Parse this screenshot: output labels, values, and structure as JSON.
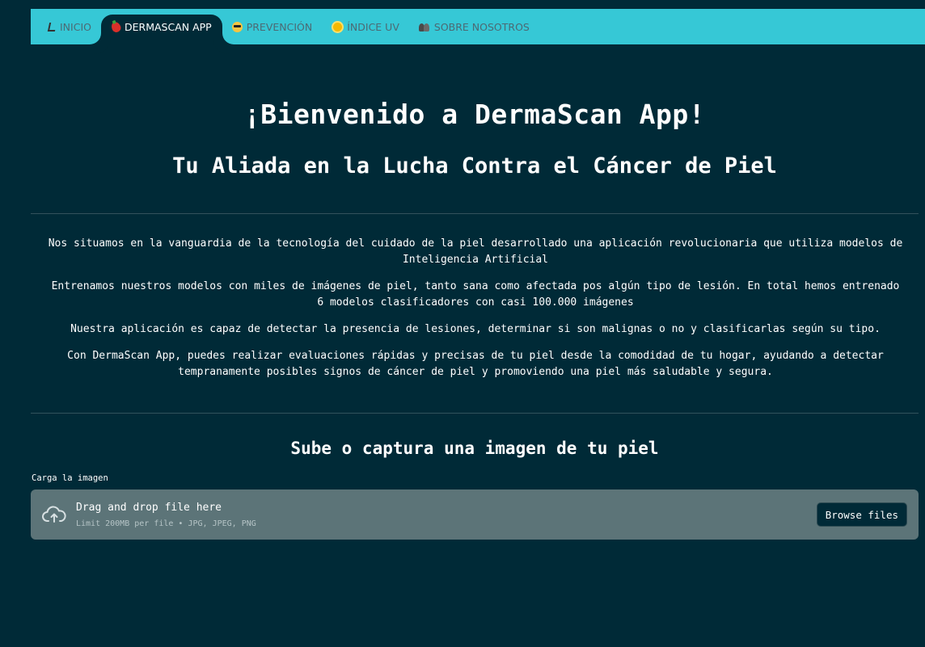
{
  "nav": {
    "items": [
      {
        "label": "INICIO",
        "icon": "home-icon",
        "active": false
      },
      {
        "label": "DERMASCAN APP",
        "icon": "pepper-icon",
        "active": true
      },
      {
        "label": "PREVENCIÓN",
        "icon": "cool-face-icon",
        "active": false
      },
      {
        "label": "ÍNDICE UV",
        "icon": "sun-icon",
        "active": false
      },
      {
        "label": "SOBRE NOSOTROS",
        "icon": "people-icon",
        "active": false
      }
    ],
    "bar_color": "#36c8d6"
  },
  "main": {
    "title": "¡Bienvenido a DermaScan App!",
    "subtitle": "Tu Aliada en la Lucha Contra el Cáncer de Piel",
    "paragraphs": [
      "Nos situamos en la vanguardia de la tecnología del cuidado de la piel desarrollado una aplicación revolucionaria que utiliza modelos de Inteligencia Artificial",
      "Entrenamos nuestros modelos con miles de imágenes de piel, tanto sana como afectada pos algún tipo de lesión. En total hemos entrenado 6 modelos clasificadores con casi 100.000 imágenes",
      "Nuestra aplicación es capaz de detectar la presencia de lesiones, determinar si son malignas o no y clasificarlas según su tipo.",
      "Con DermaScan App, puedes realizar evaluaciones rápidas y precisas de tu piel desde la comodidad de tu hogar, ayudando a detectar tempranamente posibles signos de cáncer de piel y promoviendo una piel más saludable y segura."
    ]
  },
  "upload": {
    "heading": "Sube o captura una imagen de tu piel",
    "label": "Carga la imagen",
    "drop_text": "Drag and drop file here",
    "limit_text": "Limit 200MB per file • JPG, JPEG, PNG",
    "browse_label": "Browse files"
  },
  "colors": {
    "background": "#002a37",
    "dropzone": "#5c7478"
  }
}
